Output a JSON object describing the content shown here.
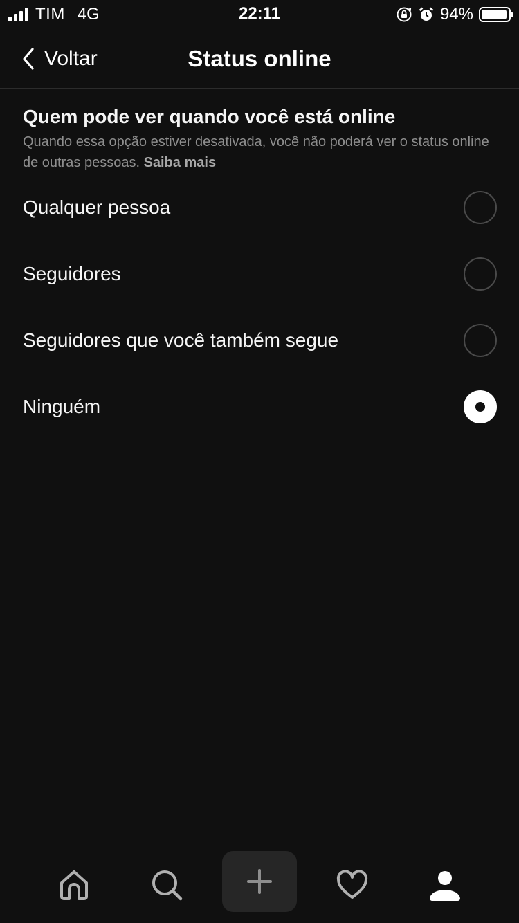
{
  "status_bar": {
    "carrier": "TIM",
    "network": "4G",
    "time": "22:11",
    "battery_percent_text": "94%",
    "battery_level": 0.94,
    "icons": [
      "signal-icon",
      "orientation-lock-icon",
      "alarm-icon",
      "battery-icon"
    ]
  },
  "nav": {
    "back_label": "Voltar",
    "title": "Status online"
  },
  "section": {
    "heading": "Quem pode ver quando você está online",
    "description": "Quando essa opção estiver desativada, você não poderá ver o status online de outras pessoas.",
    "link": "Saiba mais"
  },
  "options": [
    {
      "label": "Qualquer pessoa",
      "selected": false
    },
    {
      "label": "Seguidores",
      "selected": false
    },
    {
      "label": "Seguidores que você também segue",
      "selected": false
    },
    {
      "label": "Ninguém",
      "selected": true
    }
  ],
  "tabbar": {
    "tabs": [
      "home-icon",
      "search-icon",
      "create-icon",
      "heart-icon",
      "profile-icon"
    ]
  },
  "colors": {
    "background": "#101010",
    "text": "#f5f5f5",
    "muted_text": "#8e8e8e",
    "radio_border": "#4a4a4a",
    "create_button_bg": "#262626"
  }
}
